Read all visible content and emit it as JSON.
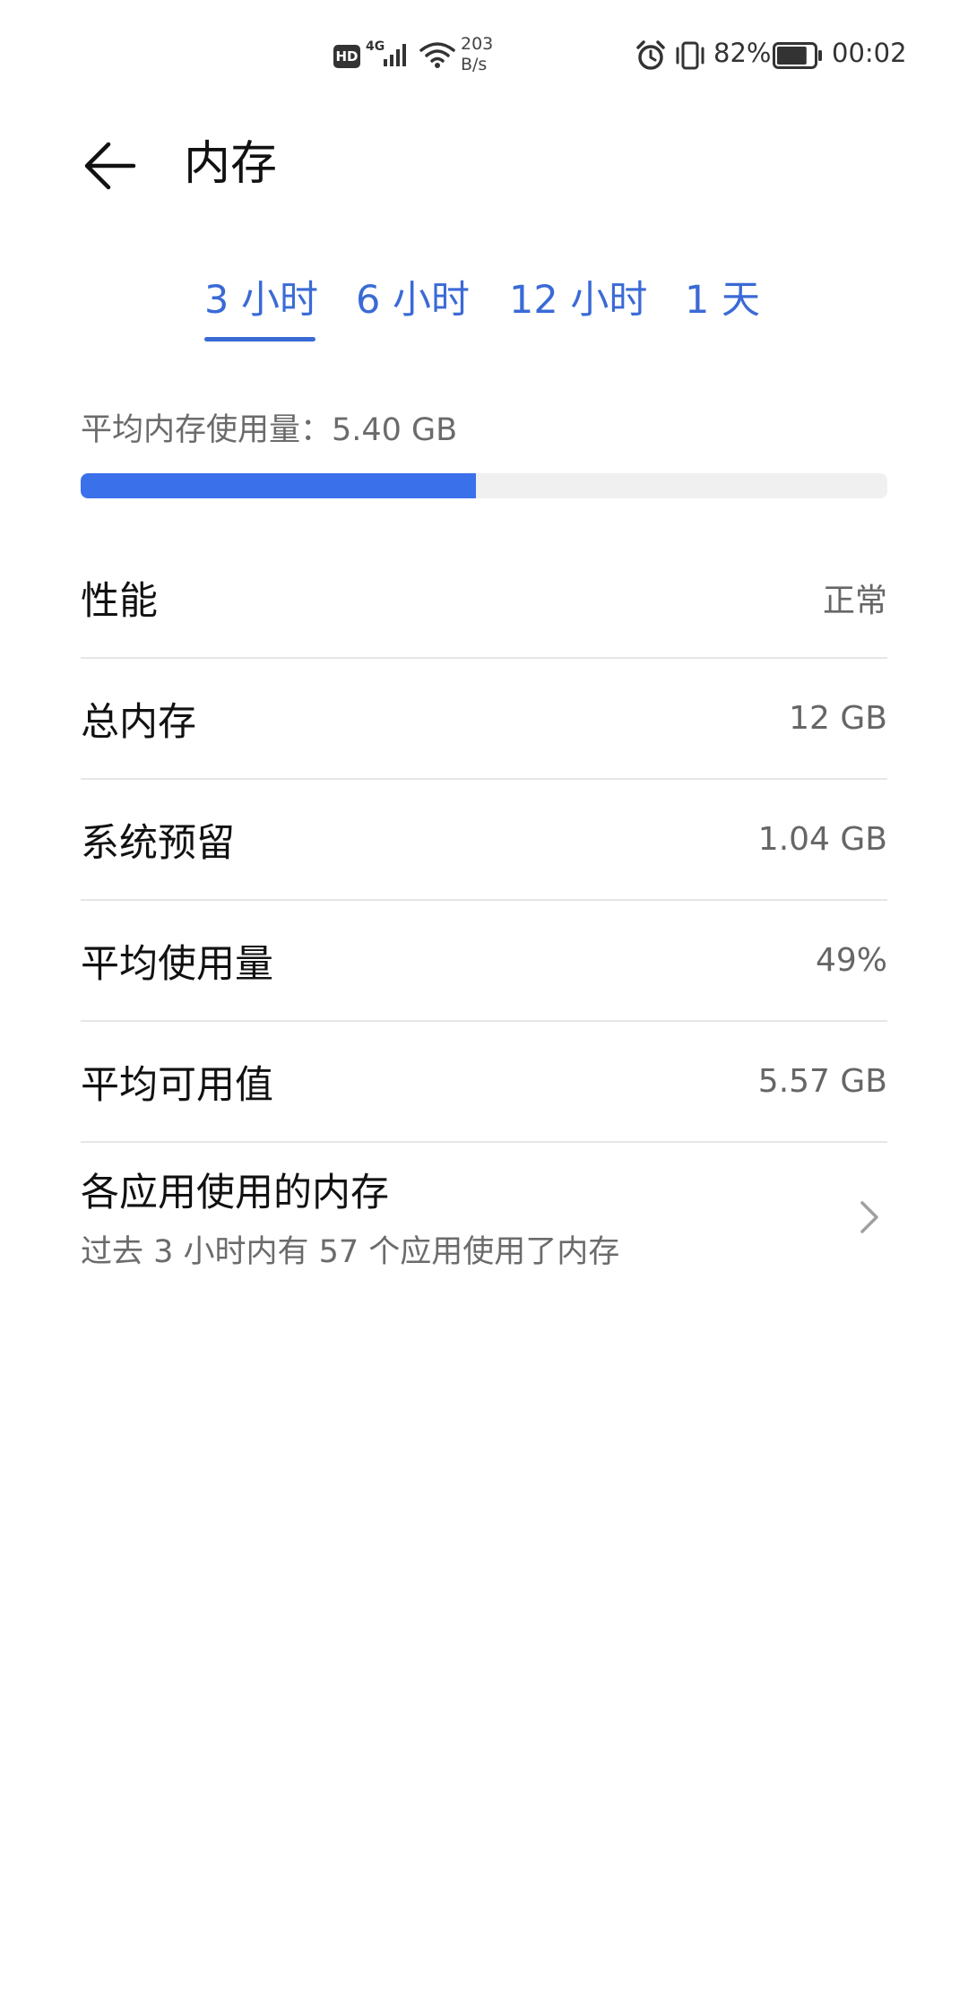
{
  "status_bar": {
    "hd": "HD",
    "network_type": "4G",
    "speed_value": "203",
    "speed_unit": "B/s",
    "battery_percent": "82%",
    "battery_level": 0.82,
    "time": "00:02",
    "icons": [
      "signal-icon",
      "wifi-icon",
      "alarm-icon",
      "vibrate-icon",
      "battery-icon"
    ]
  },
  "header": {
    "back_icon": "back-arrow-icon",
    "title": "内存"
  },
  "tabs": [
    {
      "label": "3 小时",
      "selected": true
    },
    {
      "label": "6 小时",
      "selected": false
    },
    {
      "label": "12 小时",
      "selected": false
    },
    {
      "label": "1 天",
      "selected": false
    }
  ],
  "usage": {
    "label": "平均内存使用量：5.40 GB",
    "fraction": 0.49
  },
  "rows": [
    {
      "label": "性能",
      "value": "正常"
    },
    {
      "label": "总内存",
      "value": "12 GB"
    },
    {
      "label": "系统预留",
      "value": "1.04 GB"
    },
    {
      "label": "平均使用量",
      "value": "49%"
    },
    {
      "label": "平均可用值",
      "value": "5.57 GB"
    }
  ],
  "apps_row": {
    "title": "各应用使用的内存",
    "subtitle": "过去 3 小时内有 57 个应用使用了内存",
    "icon": "chevron-right-icon"
  },
  "colors": {
    "accent": "#3a6ad6",
    "progress_fill": "#3b70eb",
    "progress_track": "#f0f0f0",
    "divider": "#e6e6e6"
  }
}
